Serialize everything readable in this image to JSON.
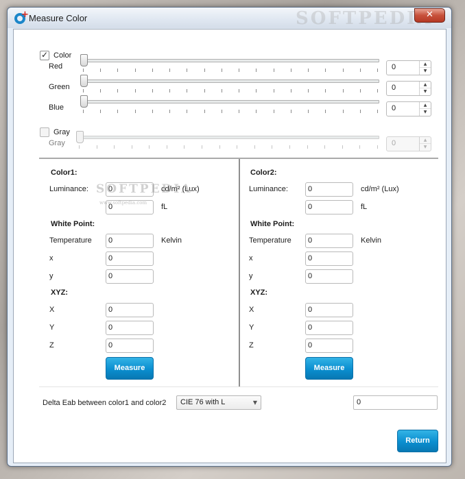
{
  "window": {
    "title": "Measure Color",
    "close_glyph": "✕"
  },
  "color_section": {
    "checkbox_label": "Color",
    "checked": true,
    "check_glyph": "✓",
    "sliders": [
      {
        "label": "Red",
        "value": "0"
      },
      {
        "label": "Green",
        "value": "0"
      },
      {
        "label": "Blue",
        "value": "0"
      }
    ]
  },
  "gray_section": {
    "checkbox_label": "Gray",
    "checked": false,
    "slider_label": "Gray",
    "value": "0"
  },
  "spin_arrows": {
    "up": "▲",
    "down": "▼"
  },
  "color1": {
    "title": "Color1:",
    "luminance_label": "Luminance:",
    "luminance_value": "0",
    "luminance_unit": "cd/m² (Lux)",
    "fl_value": "0",
    "fl_unit": "fL",
    "white_point_label": "White Point:",
    "temperature_label": "Temperature",
    "temperature_value": "0",
    "temperature_unit": "Kelvin",
    "x_label": "x",
    "x_value": "0",
    "y_label": "y",
    "y_value": "0",
    "xyz_label": "XYZ:",
    "X_label": "X",
    "X_value": "0",
    "Y_label": "Y",
    "Y_value": "0",
    "Z_label": "Z",
    "Z_value": "0",
    "measure_button": "Measure"
  },
  "color2": {
    "title": "Color2:",
    "luminance_label": "Luminance:",
    "luminance_value": "0",
    "luminance_unit": "cd/m² (Lux)",
    "fl_value": "0",
    "fl_unit": "fL",
    "white_point_label": "White Point:",
    "temperature_label": "Temperature",
    "temperature_value": "0",
    "temperature_unit": "Kelvin",
    "x_label": "x",
    "x_value": "0",
    "y_label": "y",
    "y_value": "0",
    "xyz_label": "XYZ:",
    "X_label": "X",
    "X_value": "0",
    "Y_label": "Y",
    "Y_value": "0",
    "Z_label": "Z",
    "Z_value": "0",
    "measure_button": "Measure"
  },
  "delta": {
    "label": "Delta Eab between color1 and color2",
    "method_selected": "CIE 76 with L",
    "dropdown_glyph": "▼",
    "result_value": "0"
  },
  "return_button": "Return",
  "watermarks": {
    "titlebar": "SOFTPEDIA",
    "body": "SOFTPEDIA",
    "url": "www.softpedia.com"
  }
}
